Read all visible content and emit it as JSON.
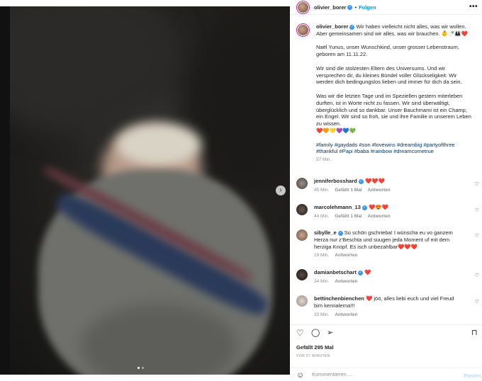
{
  "post": {
    "username": "olivier_borer",
    "follow_label": "Folgen",
    "separator": "•",
    "more_label": "•••",
    "caption": {
      "line1": "Wir haben vielleicht nicht alles, was wir wollen. Aber gemeinsamen sind wir alles, was wir brauchen. 👶🍼👨‍👨‍👦❤️",
      "p2": "Naël Yunus, unser Wunschkind, unser grosser Lebenstraum, geboren am 11.11.22.",
      "p3": "Wir sind die stolzesten Eltern des Universums. Und wir versprechen dir, du kleines Bündel voller Glückseligkeit: Wir werden dich bedingungslos lieben und immer für dich da sein.",
      "p4": "Was wir die letzten Tage und im Speziellen gestern miterleben durften, ist in Worte nicht zu fassen. Wir sind überwältigt, überglücklich und so dankbar. Unser Bauchmami ist ein Champ, ein Engel. Wir sind so froh, sie und ihre Familie in unserem Leben zu wissen.",
      "emoji_line": "❤️🧡💛💜💙💚",
      "hashtags": "#family #gaydads #son #lovewins #dreambig #partyofthree #thankful #Papi #baba #rainbow #dreamcometrue",
      "time": "57 Min."
    }
  },
  "comments": [
    {
      "user": "jenniferbosshard",
      "verified": true,
      "text": "❤️❤️❤️",
      "time": "45 Min.",
      "likes": "Gefällt 1 Mal",
      "reply": "Antworten"
    },
    {
      "user": "marcolehmann_13",
      "verified": true,
      "text": "❤️😍❤️",
      "time": "44 Min.",
      "likes": "Gefällt 1 Mal",
      "reply": "Antworten"
    },
    {
      "user": "sibylle_e",
      "verified": true,
      "text": "So schön gschrieba! I wünscha eu vo ganzem Herza nur z'Beschta und suugen jeda Moment uf mit dem herziga Knopf. Es isch unbezahlbar❤️❤️❤️",
      "time": "19 Min.",
      "reply": "Antworten"
    },
    {
      "user": "damianbetschart",
      "verified": true,
      "text": "❤️",
      "time": "34 Min.",
      "reply": "Antworten"
    },
    {
      "user": "bettinchenbienchen",
      "verified": false,
      "text": "❤️ jöö, alles liebi euch und viel Freud bim kennalerna!!!",
      "time": "33 Min.",
      "reply": "Antworten"
    }
  ],
  "actions": {
    "like_icon": "heart-icon",
    "comment_icon": "comment-icon",
    "share_icon": "share-icon",
    "save_icon": "bookmark-icon"
  },
  "likes_text": "Gefällt 295 Mal",
  "posted_ago": "VOR 57 MINUTEN",
  "comment_input": {
    "placeholder": "Kommentieren ...",
    "post_label": "Posten"
  },
  "colors": {
    "link": "#00376b",
    "follow": "#0095f6",
    "heart": "#ed4956",
    "verified": "#3897f0"
  }
}
